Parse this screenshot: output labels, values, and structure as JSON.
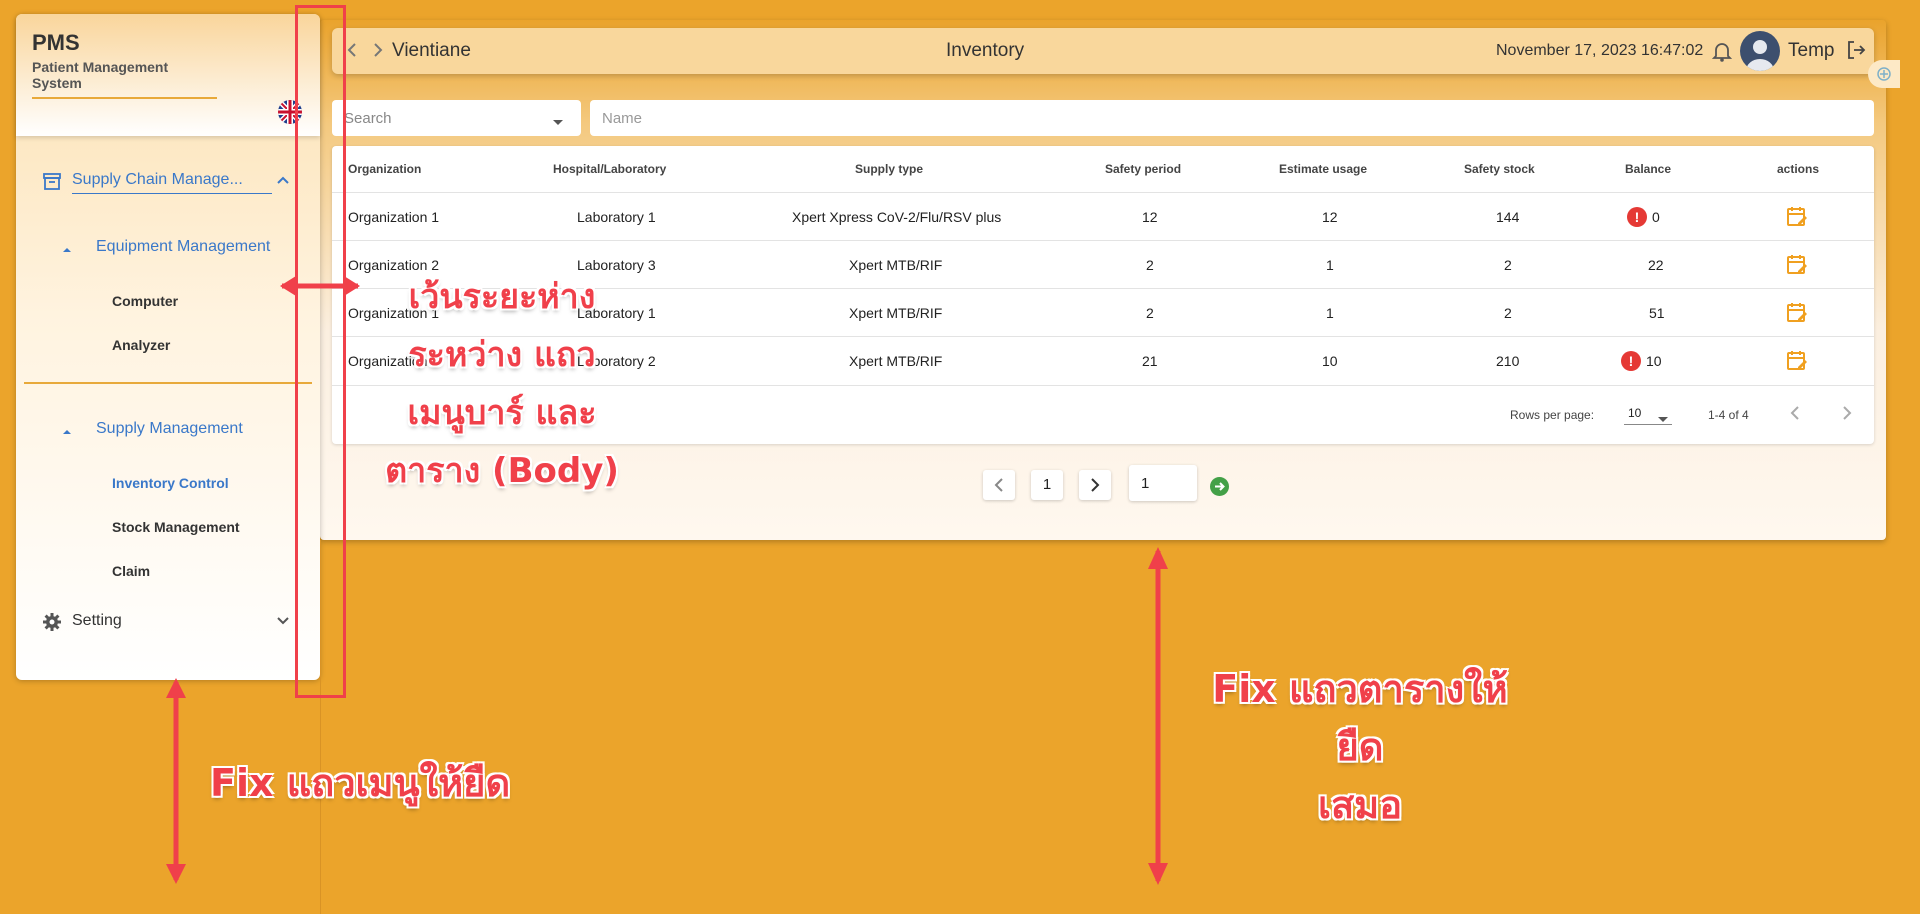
{
  "app": {
    "title": "PMS",
    "subtitle": "Patient Management System"
  },
  "sidebar": {
    "items": [
      {
        "label": "Supply Chain Manage..."
      },
      {
        "label": "Equipment Management"
      },
      {
        "label": "Computer"
      },
      {
        "label": "Analyzer"
      },
      {
        "label": "Supply Management"
      },
      {
        "label": "Inventory Control"
      },
      {
        "label": "Stock Management"
      },
      {
        "label": "Claim"
      },
      {
        "label": "Setting"
      }
    ]
  },
  "header": {
    "location": "Vientiane",
    "title": "Inventory",
    "datetime": "November 17, 2023 16:47:02",
    "user": "Temp"
  },
  "filters": {
    "search_placeholder": "Search",
    "name_placeholder": "Name"
  },
  "table": {
    "columns": [
      "Organization",
      "Hospital/Laboratory",
      "Supply type",
      "Safety period",
      "Estimate usage",
      "Safety stock",
      "Balance",
      "actions"
    ],
    "rows": [
      {
        "org": "Organization 1",
        "lab": "Laboratory 1",
        "supply": "Xpert Xpress CoV-2/Flu/RSV plus",
        "period": "12",
        "usage": "12",
        "stock": "144",
        "balance": "0"
      },
      {
        "org": "Organization 2",
        "lab": "Laboratory 3",
        "supply": "Xpert MTB/RIF",
        "period": "2",
        "usage": "1",
        "stock": "2",
        "balance": "22"
      },
      {
        "org": "Organization 1",
        "lab": "Laboratory 1",
        "supply": "Xpert MTB/RIF",
        "period": "2",
        "usage": "1",
        "stock": "2",
        "balance": "51"
      },
      {
        "org": "Organization 2",
        "lab": "Laboratory 2",
        "supply": "Xpert MTB/RIF",
        "period": "21",
        "usage": "10",
        "stock": "210",
        "balance": "10"
      }
    ],
    "rows_per_page_label": "Rows per page:",
    "rows_per_page": "10",
    "range": "1-4 of 4"
  },
  "pagination": {
    "current": "1",
    "goto": "1"
  },
  "annotations": {
    "spacing": [
      "เว้นระยะห่าง",
      "ระหว่าง แถว",
      "เมนูบาร์ และ",
      "ตาราง (Body)"
    ],
    "fix_menu": "Fix แถวเมนูให้ยืด",
    "fix_table": [
      "Fix แถวตารางให้ยืด",
      "เสมอ"
    ]
  },
  "colors": {
    "background": "#eba42b",
    "accent_blue": "#3a78c9",
    "alert_red": "#e53935",
    "annotation_red": "#f0404a"
  }
}
